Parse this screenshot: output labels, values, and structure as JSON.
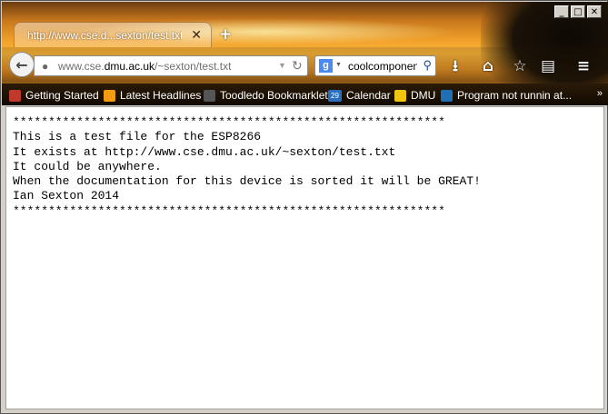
{
  "window": {
    "controls": {
      "minimize": "_",
      "maximize": "□",
      "close": "✕"
    }
  },
  "tab": {
    "title": "http://www.cse.d...sexton/test.txt",
    "close": "✕",
    "new_tab": "+"
  },
  "navbar": {
    "back_icon": "back-arrow-icon",
    "url_prefix": "www.cse.",
    "url_domain": "dmu.ac.uk",
    "url_path": "/~sexton/test.txt",
    "search_engine_icon": "google-icon",
    "search_value": "coolcomponents",
    "icons": [
      "download-icon",
      "home-icon",
      "bookmark-star-icon",
      "clipboard-icon",
      "menu-icon"
    ]
  },
  "bookmarks": [
    {
      "label": "Getting Started",
      "color": "#c0392b"
    },
    {
      "label": "Latest Headlines",
      "color": "#f39c12"
    },
    {
      "label": "Toodledo Bookmarklet",
      "color": "#555555"
    },
    {
      "label": "Calendar",
      "color": "#2a6fbf",
      "badge": "29"
    },
    {
      "label": "DMU",
      "color": "#f1c40f"
    },
    {
      "label": "Program not runnin at...",
      "color": "#1f6fb5"
    }
  ],
  "content": {
    "lines": [
      "*************************************************************",
      "This is a test file for the ESP8266",
      "It exists at http://www.cse.dmu.ac.uk/~sexton/test.txt",
      "It could be anywhere.",
      "When the documentation for this device is sorted it will be GREAT!",
      "Ian Sexton 2014",
      "*************************************************************"
    ]
  }
}
